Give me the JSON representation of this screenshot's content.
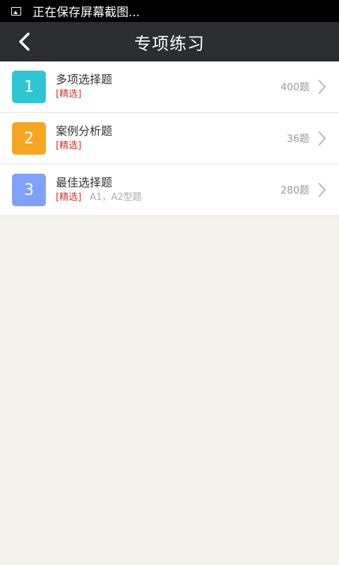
{
  "status_bar": {
    "text": "正在保存屏幕截图...",
    "icon": "screenshot-icon"
  },
  "header": {
    "title": "专项练习",
    "back_icon": "chevron-left-icon"
  },
  "items": [
    {
      "number": "1",
      "name": "多项选择题",
      "tag": "[精选]",
      "sub": "",
      "count": "400题",
      "color": "#2ec6d2"
    },
    {
      "number": "2",
      "name": "案例分析题",
      "tag": "[精选]",
      "sub": "",
      "count": "36题",
      "color": "#f6a623"
    },
    {
      "number": "3",
      "name": "最佳选择题",
      "tag": "[精选]",
      "sub": "A1，A2型题",
      "count": "280题",
      "color": "#7fa1f7"
    }
  ]
}
